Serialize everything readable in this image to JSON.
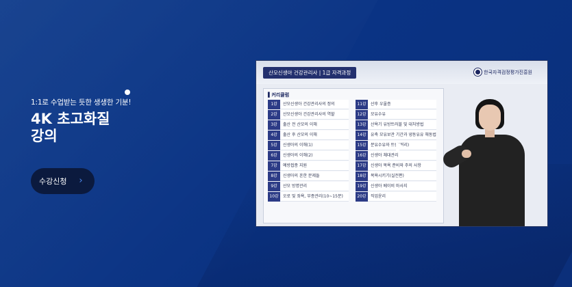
{
  "hero": {
    "subtitle": "1:1로 수업받는 듯한 생생한 기분!",
    "headline_line1": "4K 초고화질",
    "headline_line2": "강의",
    "cta_label": "수강신청",
    "cta_icon": "chevron-right-icon"
  },
  "video": {
    "course_badge": "산모신생아 건강관리사 | 1급 자격과정",
    "org_name": "한국자격검정평가진흥원",
    "curriculum_title": "▌커리큘럼",
    "lessons_left": [
      {
        "num": "1강",
        "title": "산모신생아 건강관리사의 정의"
      },
      {
        "num": "2강",
        "title": "산모신생아 건강관리사의 역할"
      },
      {
        "num": "3강",
        "title": "출산 전 산모의 이해"
      },
      {
        "num": "4강",
        "title": "출산 후 산모의 이해"
      },
      {
        "num": "5강",
        "title": "신생아의 이해(1)"
      },
      {
        "num": "6강",
        "title": "신생아의 이해(2)"
      },
      {
        "num": "7강",
        "title": "예방접종 지원"
      },
      {
        "num": "8강",
        "title": "신생아의 흔한 문제들"
      },
      {
        "num": "9강",
        "title": "산모 방명관리"
      },
      {
        "num": "10강",
        "title": "오로 및 좌욕, 부종관리(10~15분)"
      }
    ],
    "lessons_right": [
      {
        "num": "11강",
        "title": "산후 우울증"
      },
      {
        "num": "12강",
        "title": "모유수유"
      },
      {
        "num": "13강",
        "title": "산욕기 유방트러블 및 대처방법"
      },
      {
        "num": "14강",
        "title": "유축 모유보관 기간과 냉동유유 해동법"
      },
      {
        "num": "15강",
        "title": "분유수유와 트림(꺼리)"
      },
      {
        "num": "16강",
        "title": "신생아 체대관리"
      },
      {
        "num": "17강",
        "title": "신생아 목욕 준비와 주의 사항"
      },
      {
        "num": "18강",
        "title": "목욕시키기(실전편)"
      },
      {
        "num": "19강",
        "title": "신생아 베이비 마사지"
      },
      {
        "num": "20강",
        "title": "직업윤리"
      }
    ]
  },
  "colors": {
    "background": "#0a3384",
    "cta_bg": "#0b1a3e",
    "accent": "#4f8df5",
    "lesson_num_bg": "#2c3b86"
  }
}
